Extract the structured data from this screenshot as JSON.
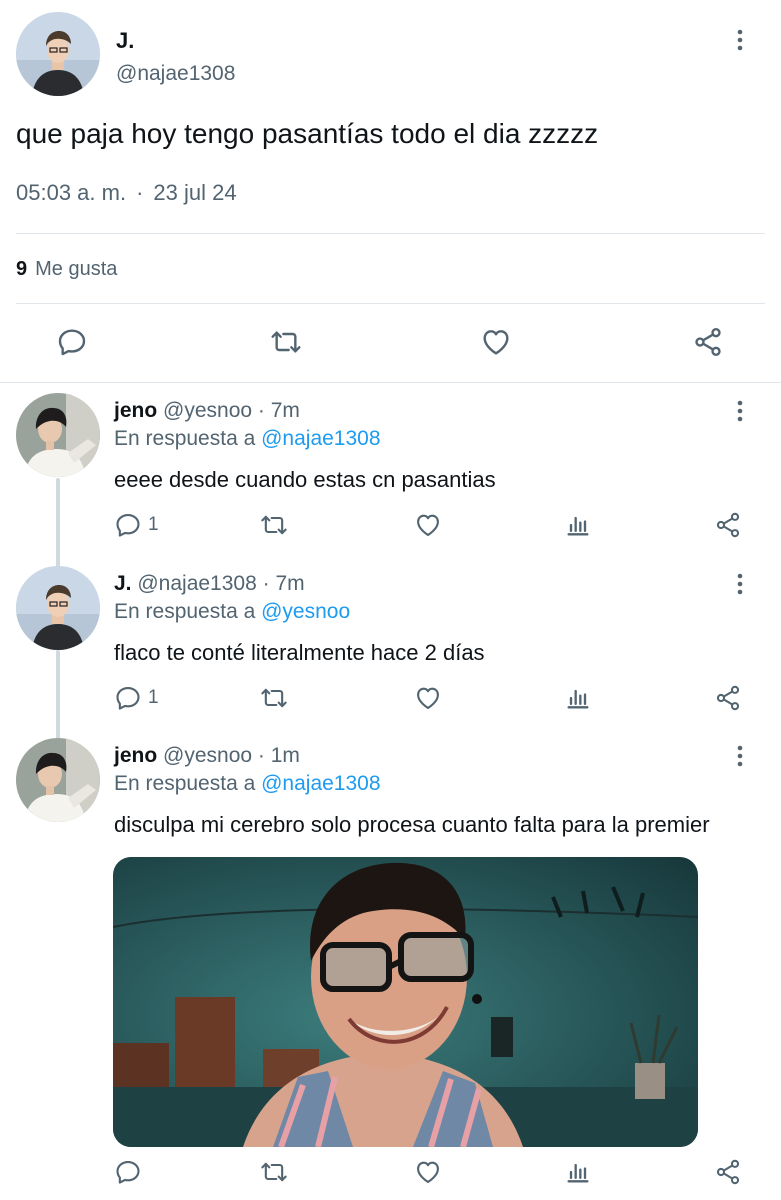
{
  "main_tweet": {
    "display_name": "J.",
    "handle": "@najae1308",
    "text": "que paja hoy tengo pasantías todo el dia zzzzz",
    "time": "05:03 a. m.",
    "separator": "·",
    "date": "23 jul 24",
    "likes_count": "9",
    "likes_label": "Me gusta",
    "actions": [
      "reply-icon",
      "retweet-icon",
      "like-icon",
      "share-icon"
    ]
  },
  "replies": [
    {
      "name": "jeno",
      "handle": "@yesnoo",
      "time": "· 7m",
      "replying_prefix": "En respuesta a",
      "replying_to": "@najae1308",
      "text": "eeee desde cuando estas cn pasantias",
      "reply_count": "1"
    },
    {
      "name": "J.",
      "handle": "@najae1308",
      "time": "· 7m",
      "replying_prefix": "En respuesta a",
      "replying_to": "@yesnoo",
      "text": "flaco te conté literalmente hace 2 días",
      "reply_count": "1"
    },
    {
      "name": "jeno",
      "handle": "@yesnoo",
      "time": "· 1m",
      "replying_prefix": "En respuesta a",
      "replying_to": "@najae1308",
      "text": "disculpa mi cerebro solo procesa cuanto falta para la premier",
      "reply_count": ""
    }
  ],
  "colors": {
    "text": "#0f1419",
    "muted": "#536471",
    "link": "#1d9bf0",
    "divider": "#e1e6ea",
    "thread_line": "#cfd9de"
  }
}
